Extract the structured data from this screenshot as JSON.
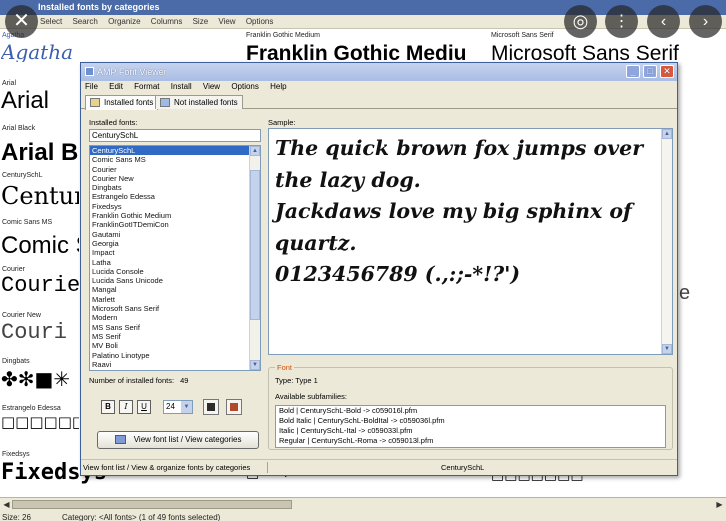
{
  "background_window": {
    "title": "Installed fonts by categories",
    "toolbar": [
      "Select",
      "Search",
      "Organize",
      "Columns",
      "Size",
      "View",
      "Options"
    ],
    "samples_col1": [
      {
        "label": "Agatha",
        "sample": "Agatha"
      },
      {
        "label": "Arial",
        "sample": "Arial"
      },
      {
        "label": "Arial Black",
        "sample": "Arial B"
      },
      {
        "label": "CenturySchL",
        "sample": "Centur"
      },
      {
        "label": "Comic Sans MS",
        "sample": "Comic S"
      },
      {
        "label": "Courier",
        "sample": "Courie"
      },
      {
        "label": "Courier New",
        "sample": "Couri"
      },
      {
        "label": "Dingbats",
        "sample": "✤✻■✳"
      },
      {
        "label": "Estrangelo Edessa",
        "sample": "□□□□□□□"
      },
      {
        "label": "Fixedsys",
        "sample": "Fixedsys"
      }
    ],
    "samples_col2": [
      {
        "label": "Franklin Gothic Medium",
        "sample": "Franklin Gothic Mediu"
      }
    ],
    "samples_col3": [
      {
        "label": "Microsoft Sans Serif",
        "sample": "Microsoft Sans Serif"
      }
    ],
    "stray_glyphs": {
      "e": "e",
      "boxes": "□□□□□□□",
      "marks": "□ ✕ ↑"
    },
    "status": {
      "size": "Size: 26",
      "category": "Category: <All fonts> (1 of 49 fonts selected)"
    }
  },
  "amp_font_viewer": {
    "title": "AMP Font Viewer",
    "menu": [
      "File",
      "Edit",
      "Format",
      "Install",
      "View",
      "Options",
      "Help"
    ],
    "tabs": [
      "Installed fonts",
      "Not installed fonts"
    ],
    "installed_fonts_label": "Installed fonts:",
    "font_search_value": "CenturySchL",
    "font_list": [
      "CenturySchL",
      "Comic Sans MS",
      "Courier",
      "Courier New",
      "Dingbats",
      "Estrangelo Edessa",
      "Fixedsys",
      "Franklin Gothic Medium",
      "FranklinGotITDemiCon",
      "Gautami",
      "Georgia",
      "Impact",
      "Latha",
      "Lucida Console",
      "Lucida Sans Unicode",
      "Mangal",
      "Marlett",
      "Microsoft Sans Serif",
      "Modern",
      "MS Sans Serif",
      "MS Serif",
      "MV Boli",
      "Palatino Linotype",
      "Raavi"
    ],
    "selected_font": "CenturySchL",
    "count_label": "Number of installed fonts:",
    "count_value": "49",
    "format_buttons": {
      "bold": "B",
      "italic": "I",
      "underline": "U"
    },
    "size_value": "24",
    "view_list_button": "View font list / View categories",
    "sample_label": "Sample:",
    "sample_lines": [
      "The quick brown fox jumps over",
      "the lazy dog.",
      "Jackdaws love my big sphinx of",
      "quartz.",
      "0123456789 (.,:;-*!?')"
    ],
    "font_group_label": "Font",
    "type_text": "Type:  Type 1",
    "subfamilies_label": "Available subfamilies:",
    "subfamilies": [
      "Bold  |  CenturySchL-Bold  ->  c059016l.pfm",
      "Bold Italic  |  CenturySchL-BoldItal  ->  c059036l.pfm",
      "Italic  |  CenturySchL-Ital  ->  c059033l.pfm",
      "Regular  |  CenturySchL-Roma  ->  c059013l.pfm"
    ],
    "status_left": "View font list / View & organize fonts by categories",
    "status_right": "CenturySchL"
  },
  "colors": {
    "selection": "#316ac5",
    "dialog_border": "#3e5f9e",
    "legend_orange": "#d0500a"
  }
}
